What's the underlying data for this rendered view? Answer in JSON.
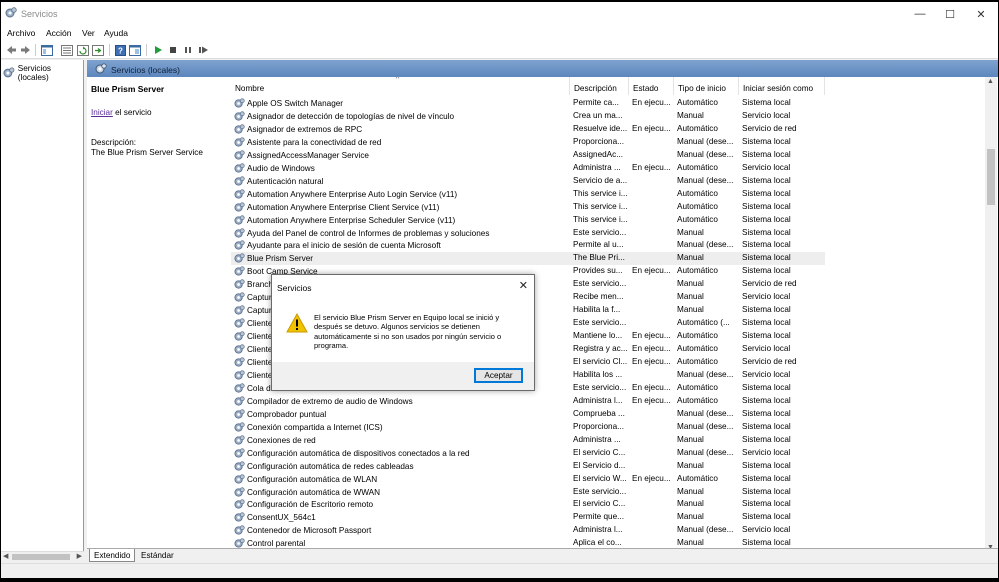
{
  "window": {
    "title": "Servicios"
  },
  "menu": [
    "Archivo",
    "Acción",
    "Ver",
    "Ayuda"
  ],
  "toolbar_icons": [
    "back-arrow-icon",
    "forward-arrow-icon",
    "console-tree-icon",
    "properties-list-icon",
    "refresh-icon",
    "export-icon",
    "help-icon",
    "mmc-view-icon",
    "play-icon",
    "stop-icon",
    "pause-icon",
    "restart-icon"
  ],
  "tree": {
    "root_label": "Servicios (locales)"
  },
  "pane": {
    "header": "Servicios (locales)"
  },
  "details": {
    "service_name": "Blue Prism Server",
    "start_link": "Iniciar",
    "start_suffix": " el servicio",
    "description_label": "Descripción:",
    "description_value": "The Blue Prism Server Service"
  },
  "columns": [
    "Nombre",
    "Descripción",
    "Estado",
    "Tipo de inicio",
    "Iniciar sesión como"
  ],
  "services": [
    {
      "name": "Apple OS Switch Manager",
      "desc": "Permite ca...",
      "status": "En ejecu...",
      "start": "Automático",
      "logon": "Sistema local"
    },
    {
      "name": "Asignador de detección de topologías de nivel de vínculo",
      "desc": "Crea un ma...",
      "status": "",
      "start": "Manual",
      "logon": "Servicio local"
    },
    {
      "name": "Asignador de extremos de RPC",
      "desc": "Resuelve ide...",
      "status": "En ejecu...",
      "start": "Automático",
      "logon": "Servicio de red"
    },
    {
      "name": "Asistente para la conectividad de red",
      "desc": "Proporciona...",
      "status": "",
      "start": "Manual (dese...",
      "logon": "Sistema local"
    },
    {
      "name": "AssignedAccessManager Service",
      "desc": "AssignedAc...",
      "status": "",
      "start": "Manual (dese...",
      "logon": "Sistema local"
    },
    {
      "name": "Audio de Windows",
      "desc": "Administra ...",
      "status": "En ejecu...",
      "start": "Automático",
      "logon": "Servicio local"
    },
    {
      "name": "Autenticación natural",
      "desc": "Servicio de a...",
      "status": "",
      "start": "Manual (dese...",
      "logon": "Sistema local"
    },
    {
      "name": "Automation Anywhere Enterprise Auto Login Service (v11)",
      "desc": "This service i...",
      "status": "",
      "start": "Automático",
      "logon": "Sistema local"
    },
    {
      "name": "Automation Anywhere Enterprise Client Service (v11)",
      "desc": "This service i...",
      "status": "",
      "start": "Automático",
      "logon": "Sistema local"
    },
    {
      "name": "Automation Anywhere Enterprise Scheduler Service (v11)",
      "desc": "This service i...",
      "status": "",
      "start": "Automático",
      "logon": "Sistema local"
    },
    {
      "name": "Ayuda del Panel de control de Informes de problemas y soluciones",
      "desc": "Este servicio...",
      "status": "",
      "start": "Manual",
      "logon": "Sistema local"
    },
    {
      "name": "Ayudante para el inicio de sesión de cuenta Microsoft",
      "desc": "Permite al u...",
      "status": "",
      "start": "Manual (dese...",
      "logon": "Sistema local"
    },
    {
      "name": "Blue Prism Server",
      "desc": "The Blue Pri...",
      "status": "",
      "start": "Manual",
      "logon": "Sistema local",
      "selected": "true"
    },
    {
      "name": "Boot Camp Service",
      "desc": "Provides su...",
      "status": "En ejecu...",
      "start": "Automático",
      "logon": "Sistema local"
    },
    {
      "name": "Branch",
      "desc": "Este servicio...",
      "status": "",
      "start": "Manual",
      "logon": "Servicio de red"
    },
    {
      "name": "Captur",
      "desc": "Recibe men...",
      "status": "",
      "start": "Manual",
      "logon": "Servicio local"
    },
    {
      "name": "Captur",
      "desc": "Habilita la f...",
      "status": "",
      "start": "Manual",
      "logon": "Sistema local"
    },
    {
      "name": "Cliente",
      "desc": "Este servicio...",
      "status": "",
      "start": "Automático (...",
      "logon": "Sistema local"
    },
    {
      "name": "Cliente",
      "desc": "Mantiene lo...",
      "status": "En ejecu...",
      "start": "Automático",
      "logon": "Sistema local"
    },
    {
      "name": "Cliente",
      "desc": "Registra y ac...",
      "status": "En ejecu...",
      "start": "Automático",
      "logon": "Servicio local"
    },
    {
      "name": "Cliente",
      "desc": "El servicio Cl...",
      "status": "En ejecu...",
      "start": "Automático",
      "logon": "Servicio de red"
    },
    {
      "name": "Cliente",
      "desc": "Habilita los ...",
      "status": "",
      "start": "Manual (dese...",
      "logon": "Servicio local"
    },
    {
      "name": "Cola d",
      "desc": "Este servicio...",
      "status": "En ejecu...",
      "start": "Automático",
      "logon": "Sistema local"
    },
    {
      "name": "Compilador de extremo de audio de Windows",
      "desc": "Administra l...",
      "status": "En ejecu...",
      "start": "Automático",
      "logon": "Sistema local"
    },
    {
      "name": "Comprobador puntual",
      "desc": "Comprueba ...",
      "status": "",
      "start": "Manual (dese...",
      "logon": "Sistema local"
    },
    {
      "name": "Conexión compartida a Internet (ICS)",
      "desc": "Proporciona...",
      "status": "",
      "start": "Manual (dese...",
      "logon": "Sistema local"
    },
    {
      "name": "Conexiones de red",
      "desc": "Administra ...",
      "status": "",
      "start": "Manual",
      "logon": "Sistema local"
    },
    {
      "name": "Configuración automática de dispositivos conectados a la red",
      "desc": "El servicio C...",
      "status": "",
      "start": "Manual (dese...",
      "logon": "Servicio local"
    },
    {
      "name": "Configuración automática de redes cableadas",
      "desc": "El Servicio d...",
      "status": "",
      "start": "Manual",
      "logon": "Sistema local"
    },
    {
      "name": "Configuración automática de WLAN",
      "desc": "El servicio W...",
      "status": "En ejecu...",
      "start": "Automático",
      "logon": "Sistema local"
    },
    {
      "name": "Configuración automática de WWAN",
      "desc": "Este servicio...",
      "status": "",
      "start": "Manual",
      "logon": "Sistema local"
    },
    {
      "name": "Configuración de Escritorio remoto",
      "desc": "El servicio C...",
      "status": "",
      "start": "Manual",
      "logon": "Sistema local"
    },
    {
      "name": "ConsentUX_564c1",
      "desc": "Permite que...",
      "status": "",
      "start": "Manual",
      "logon": "Sistema local"
    },
    {
      "name": "Contenedor de Microsoft Passport",
      "desc": "Administra l...",
      "status": "",
      "start": "Manual (dese...",
      "logon": "Servicio local"
    },
    {
      "name": "Control parental",
      "desc": "Aplica el co...",
      "status": "",
      "start": "Manual",
      "logon": "Sistema local"
    }
  ],
  "tabs": [
    "Extendido",
    "Estándar"
  ],
  "dialog": {
    "title": "Servicios",
    "message": "El servicio Blue Prism Server en Equipo local se inició y después se detuvo. Algunos servicios se detienen automáticamente si no son usados por ningún servicio o programa.",
    "ok_label": "Aceptar"
  },
  "colors": {
    "pane_header": "#6f96c8",
    "link": "#5a2b9a",
    "warning": "#f2c200",
    "accent": "#0078d7"
  }
}
